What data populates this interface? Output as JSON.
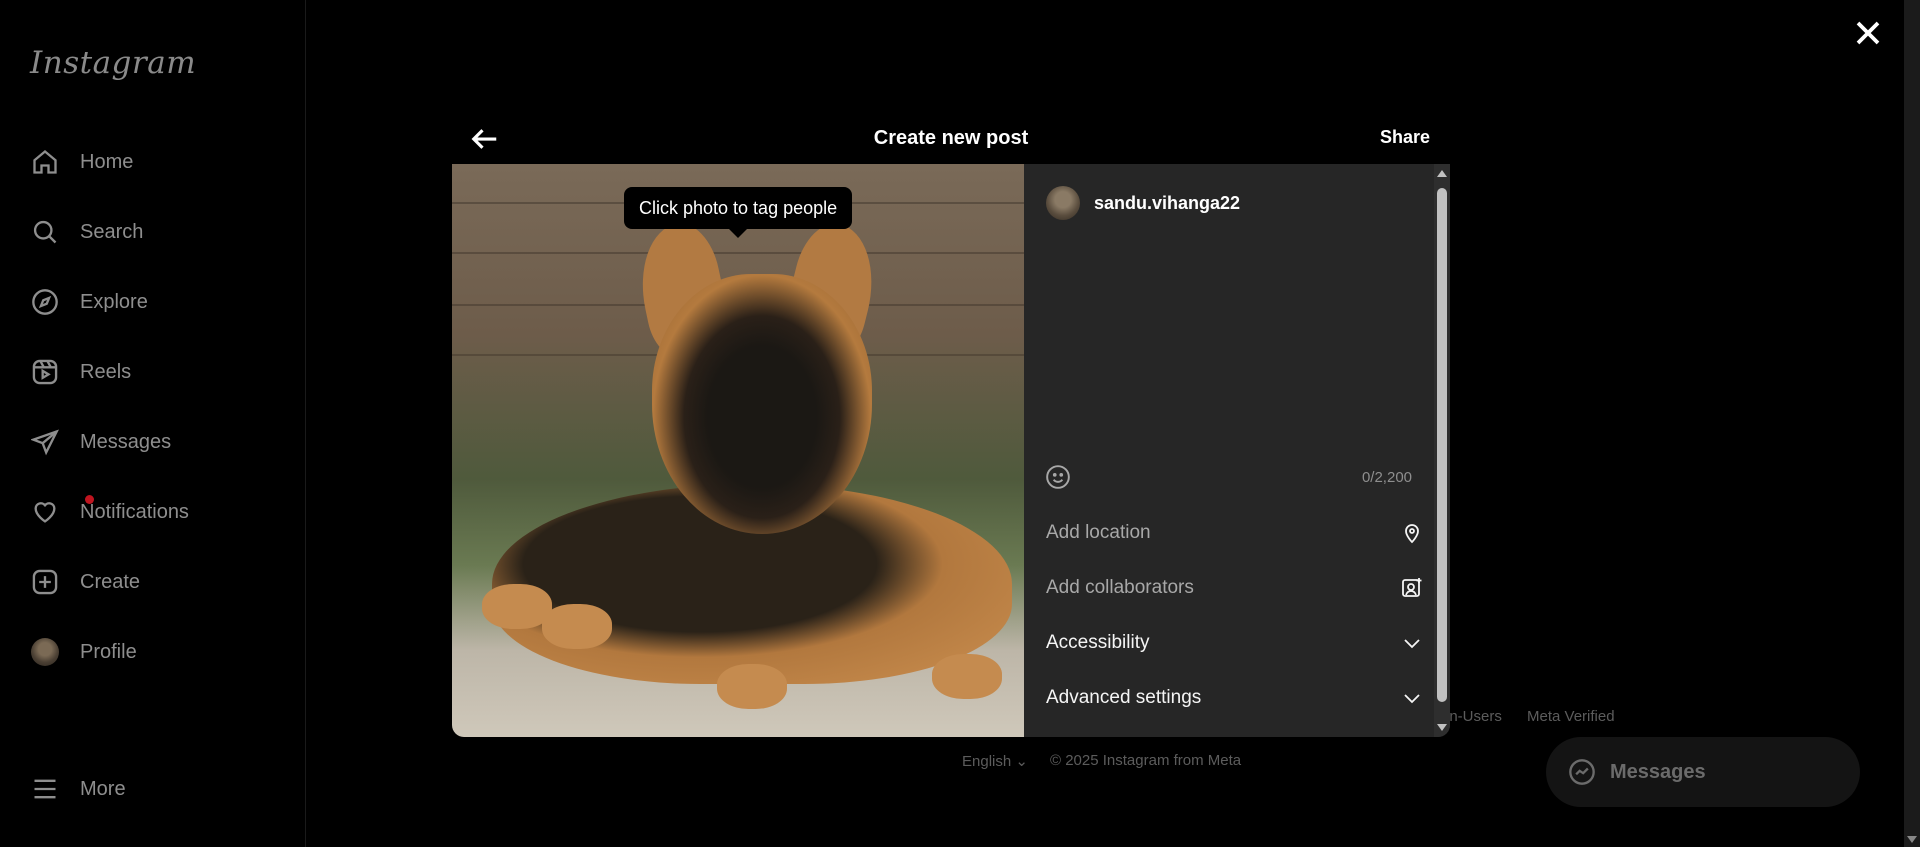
{
  "sidebar": {
    "logo": "Instagram",
    "items": [
      {
        "label": "Home"
      },
      {
        "label": "Search"
      },
      {
        "label": "Explore"
      },
      {
        "label": "Reels"
      },
      {
        "label": "Messages"
      },
      {
        "label": "Notifications"
      },
      {
        "label": "Create"
      },
      {
        "label": "Profile"
      },
      {
        "label": "More"
      }
    ]
  },
  "background": {
    "footer_partial": "on-Users",
    "footer_meta_verified": "Meta Verified",
    "language": "English",
    "copyright": "© 2025 Instagram from Meta",
    "messages_pill": "Messages"
  },
  "modal": {
    "title": "Create new post",
    "share_label": "Share",
    "tooltip": "Click photo to tag people",
    "username": "sandu.vihanga22",
    "caption_value": "",
    "char_count": "0/2,200",
    "add_location": "Add location",
    "add_collaborators": "Add collaborators",
    "accessibility": "Accessibility",
    "advanced_settings": "Advanced settings"
  }
}
